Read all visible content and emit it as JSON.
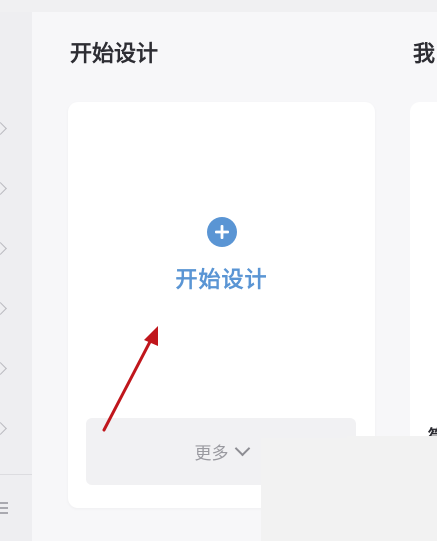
{
  "sections": {
    "start_design_title": "开始设计",
    "next_section_title_partial": "我"
  },
  "start_card": {
    "action_label": "开始设计",
    "action_icon": "plus-circle-icon",
    "more_label": "更多",
    "more_icon": "chevron-down-icon"
  },
  "sidebar": {
    "item_icon": "chevron-right-icon",
    "menu_icon": "menu-icon"
  },
  "annotation": {
    "arrow_color": "#c0161c"
  },
  "colors": {
    "accent": "#5a95d4",
    "title": "#2d2d33"
  }
}
